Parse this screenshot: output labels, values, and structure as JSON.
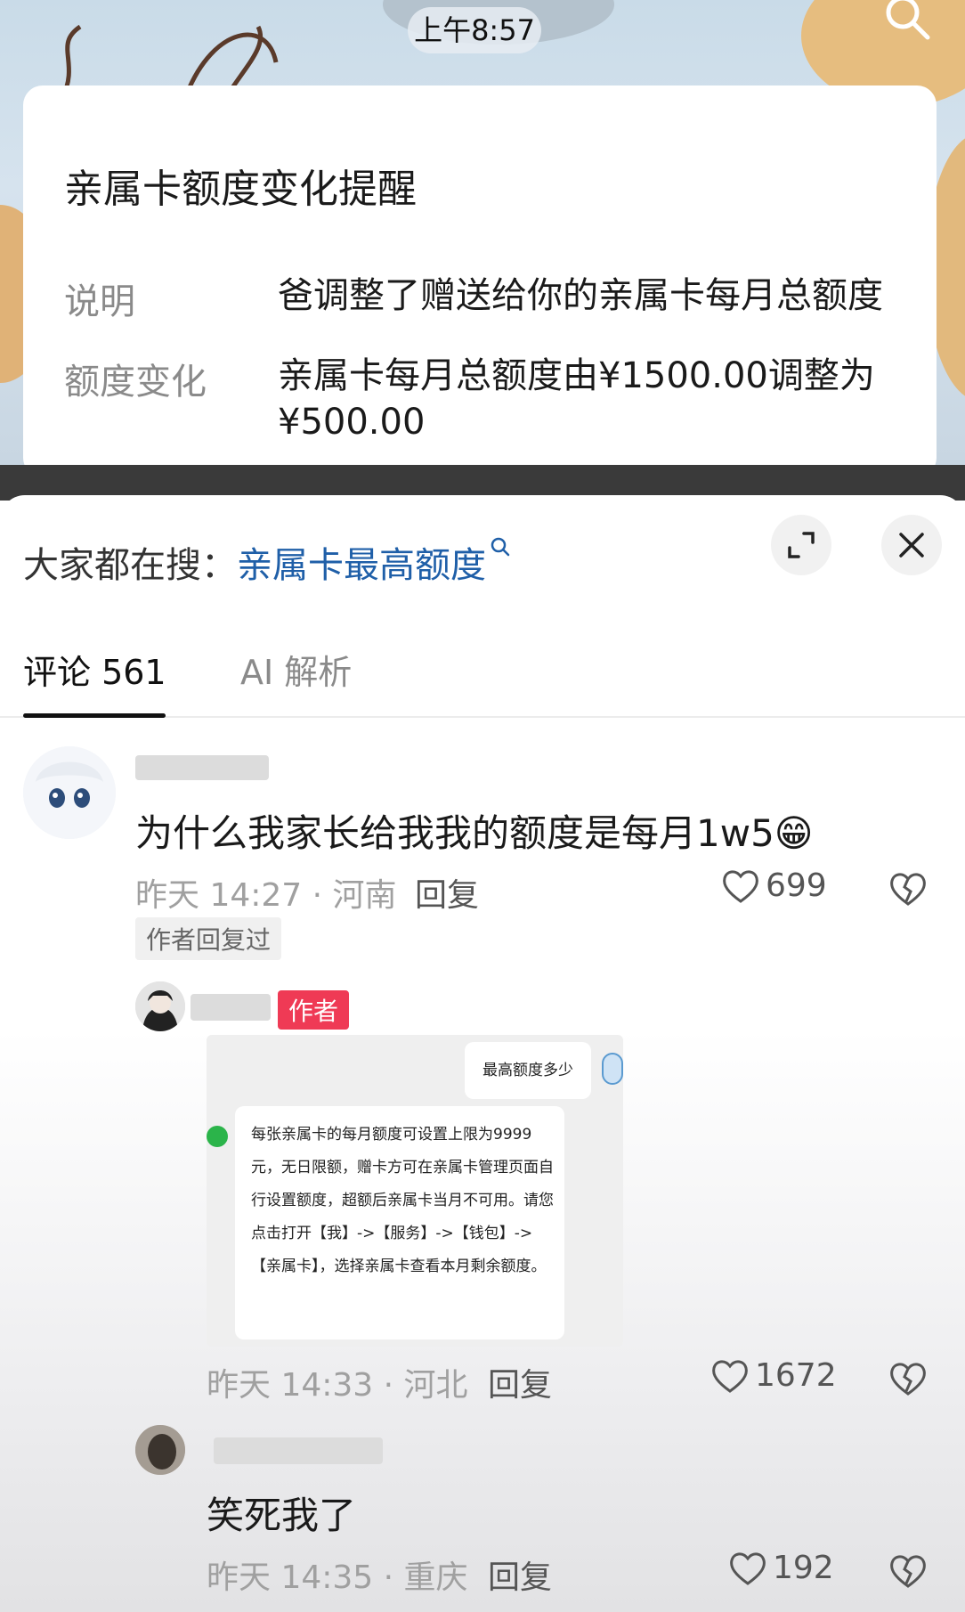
{
  "status_bar": {
    "time": "上午8:57"
  },
  "notice": {
    "title": "亲属卡额度变化提醒",
    "rows": [
      {
        "label": "说明",
        "value": "爸调整了赠送给你的亲属卡每月总额度"
      },
      {
        "label": "额度变化",
        "value": "亲属卡每月总额度由¥1500.00调整为¥500.00"
      }
    ]
  },
  "search": {
    "prefix": "大家都在搜：",
    "keyword": "亲属卡最高额度"
  },
  "tabs": [
    {
      "label": "评论 561",
      "active": true
    },
    {
      "label": "AI 解析",
      "active": false
    }
  ],
  "comments": [
    {
      "text": "为什么我家长给我我的额度是每月1w5😁",
      "time_location": "昨天 14:27 · 河南",
      "reply_label": "回复",
      "likes": "699",
      "tag": "作者回复过"
    },
    {
      "author_badge": "作者",
      "screenshot": {
        "question": "最高额度多少",
        "answer": "每张亲属卡的每月额度可设置上限为9999元，无日限额，赠卡方可在亲属卡管理页面自行设置额度，超额后亲属卡当月不可用。请您点击打开【我】->【服务】->【钱包】->【亲属卡】，选择亲属卡查看本月剩余额度。"
      },
      "time_location": "昨天 14:33 · 河北",
      "reply_label": "回复",
      "likes": "1672"
    },
    {
      "text": "笑死我了",
      "time_location": "昨天 14:35 · 重庆",
      "reply_label": "回复",
      "likes": "192"
    }
  ],
  "icons": [
    "search-icon",
    "expand-icon",
    "close-icon",
    "heart-icon",
    "dislike-icon"
  ],
  "colors": {
    "search_keyword": "#1f5fa8",
    "author_badge": "#ef3a55"
  }
}
